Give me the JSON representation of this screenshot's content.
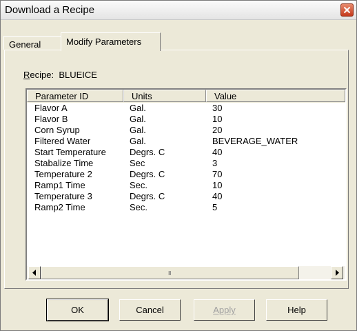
{
  "window": {
    "title": "Download a Recipe",
    "close_icon": "close-icon"
  },
  "tabs": [
    {
      "label": "General",
      "selected": false
    },
    {
      "label": "Modify Parameters",
      "selected": true
    }
  ],
  "recipe": {
    "label_first": "R",
    "label_rest": "ecipe:",
    "name": "BLUEICE"
  },
  "table": {
    "columns": [
      "Parameter ID",
      "Units",
      "Value"
    ],
    "rows": [
      [
        "Flavor A",
        "Gal.",
        "30"
      ],
      [
        "Flavor B",
        "Gal.",
        "10"
      ],
      [
        "Corn Syrup",
        "Gal.",
        "20"
      ],
      [
        "Filtered Water",
        "Gal.",
        "BEVERAGE_WATER"
      ],
      [
        "Start Temperature",
        "Degrs. C",
        "40"
      ],
      [
        "Stabalize Time",
        "Sec",
        "3"
      ],
      [
        "Temperature 2",
        "Degrs. C",
        "70"
      ],
      [
        "Ramp1 Time",
        "Sec.",
        "10"
      ],
      [
        "Temperature 3",
        "Degrs. C",
        "40"
      ],
      [
        "Ramp2 Time",
        "Sec.",
        "5"
      ]
    ]
  },
  "scrollbar": {
    "grip": "III"
  },
  "buttons": {
    "ok": "OK",
    "cancel": "Cancel",
    "apply": "Apply",
    "help": "Help"
  },
  "colors": {
    "close_button": "#c4391c",
    "dialog_bg": "#ece9d8"
  }
}
